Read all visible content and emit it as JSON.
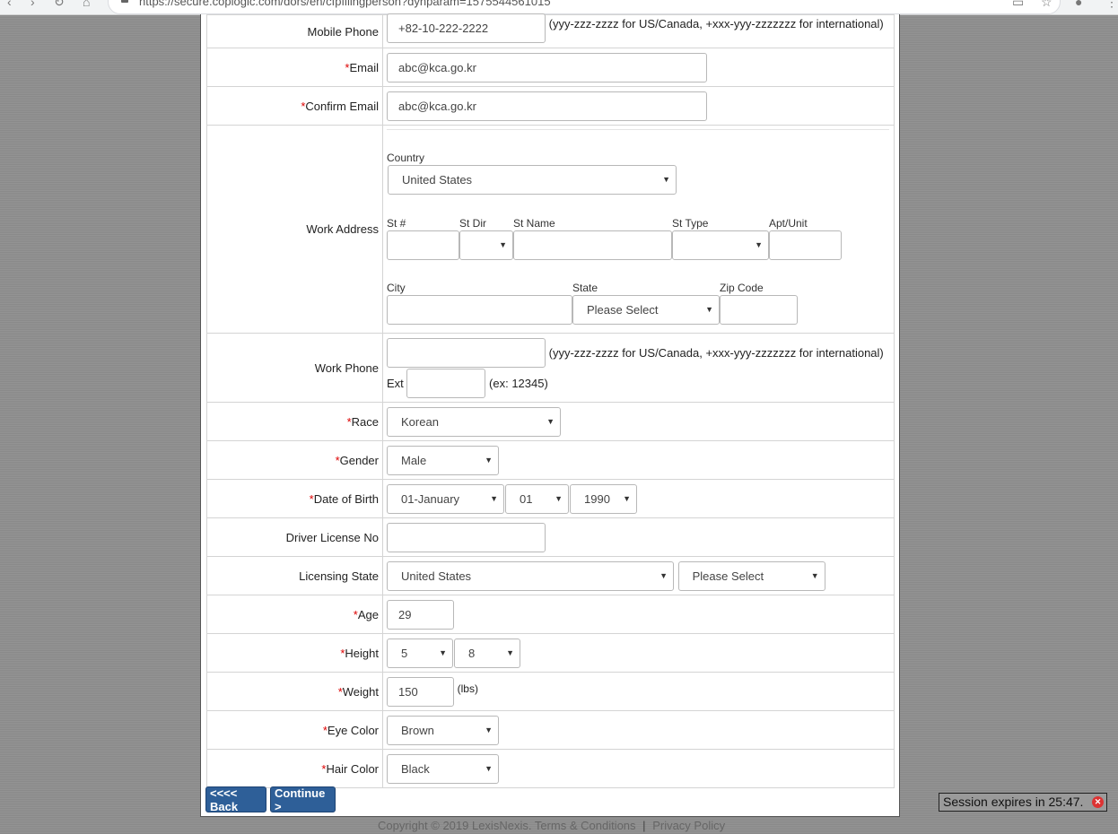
{
  "browser": {
    "url": "https://secure.coplogic.com/dors/en/cfpfilingperson?dynparam=1575544561015"
  },
  "form": {
    "mobile_phone": {
      "label": "Mobile Phone",
      "value": "+82-10-222-2222",
      "hint": "(yyy-zzz-zzzz for US/Canada, +xxx-yyy-zzzzzzz for international)"
    },
    "email": {
      "required": "*",
      "label": "Email",
      "value": "abc@kca.go.kr"
    },
    "confirm_email": {
      "required": "*",
      "label": "Confirm Email",
      "value": "abc@kca.go.kr"
    },
    "work_address": {
      "label": "Work Address",
      "country_label": "Country",
      "country_value": "United States",
      "st_num_label": "St #",
      "st_dir_label": "St Dir",
      "st_name_label": "St Name",
      "st_type_label": "St Type",
      "apt_label": "Apt/Unit",
      "city_label": "City",
      "state_label": "State",
      "state_value": "Please Select",
      "zip_label": "Zip Code"
    },
    "work_phone": {
      "label": "Work Phone",
      "hint": "(yyy-zzz-zzzz for US/Canada, +xxx-yyy-zzzzzzz for international)",
      "ext_label": "Ext",
      "ext_hint": "(ex: 12345)"
    },
    "race": {
      "required": "*",
      "label": "Race",
      "value": "Korean"
    },
    "gender": {
      "required": "*",
      "label": "Gender",
      "value": "Male"
    },
    "dob": {
      "required": "*",
      "label": "Date of Birth",
      "month": "01-January",
      "day": "01",
      "year": "1990"
    },
    "driver_license": {
      "label": "Driver License No"
    },
    "licensing_state": {
      "label": "Licensing State",
      "country": "United States",
      "state": "Please Select"
    },
    "age": {
      "required": "*",
      "label": "Age",
      "value": "29"
    },
    "height": {
      "required": "*",
      "label": "Height",
      "feet": "5",
      "inches": "8"
    },
    "weight": {
      "required": "*",
      "label": "Weight",
      "value": "150",
      "unit": "(lbs)"
    },
    "eye_color": {
      "required": "*",
      "label": "Eye Color",
      "value": "Brown"
    },
    "hair_color": {
      "required": "*",
      "label": "Hair Color",
      "value": "Black"
    }
  },
  "buttons": {
    "back": "<<<< Back",
    "continue": "Continue >"
  },
  "footer": {
    "copyright": "Copyright © 2019 LexisNexis.",
    "terms": "Terms & Conditions",
    "sep": "|",
    "privacy": "Privacy Policy"
  },
  "session": {
    "text": "Session expires in 25:47."
  },
  "icons": {
    "caret": "▼",
    "close": "close-circle-icon"
  }
}
